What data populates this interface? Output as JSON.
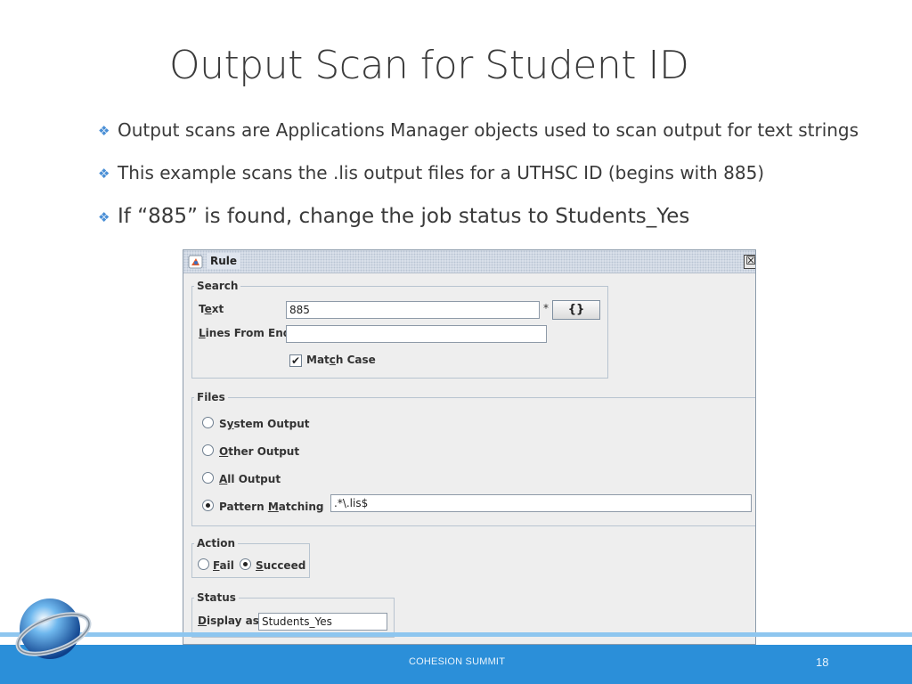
{
  "slide": {
    "title": "Output Scan for Student ID",
    "bullets": [
      "Output scans are Applications Manager objects used to scan output for text strings",
      "This example scans the .lis output files for a UTHSC ID (begins with 885)",
      "If “885” is found, change the job status to Students_Yes"
    ],
    "bullet_icon": "diamond-bullet-icon",
    "footer_text": "COHESION SUMMIT",
    "page_number": "18",
    "accent_color": "#2b8fd9"
  },
  "dialog": {
    "title": "Rule",
    "close_glyph": "☒",
    "search": {
      "legend": "Search",
      "text_label": {
        "pre": "T",
        "key": "e",
        "post": "xt"
      },
      "text_value": "885",
      "required_mark": "*",
      "braces_button": "{}",
      "lines_from_end_label": {
        "pre": "",
        "key": "L",
        "post": "ines From End"
      },
      "lines_from_end_value": "",
      "match_case_label": {
        "pre": "Mat",
        "key": "c",
        "post": "h Case"
      },
      "match_case_checked": true
    },
    "files": {
      "legend": "Files",
      "options": [
        {
          "pre": "S",
          "key": "y",
          "post": "stem Output",
          "selected": false
        },
        {
          "pre": "",
          "key": "O",
          "post": "ther Output",
          "selected": false
        },
        {
          "pre": "",
          "key": "A",
          "post": "ll Output",
          "selected": false
        },
        {
          "pre": "Pattern ",
          "key": "M",
          "post": "atching",
          "selected": true
        }
      ],
      "pattern_value": ".*\\.lis$"
    },
    "action": {
      "legend": "Action",
      "fail": {
        "pre": "",
        "key": "F",
        "post": "ail",
        "selected": false
      },
      "succeed": {
        "pre": "",
        "key": "S",
        "post": "ucceed",
        "selected": true
      }
    },
    "status": {
      "legend": "Status",
      "display_as_label": {
        "pre": "",
        "key": "D",
        "post": "isplay as"
      },
      "display_as_value": "Students_Yes"
    }
  }
}
